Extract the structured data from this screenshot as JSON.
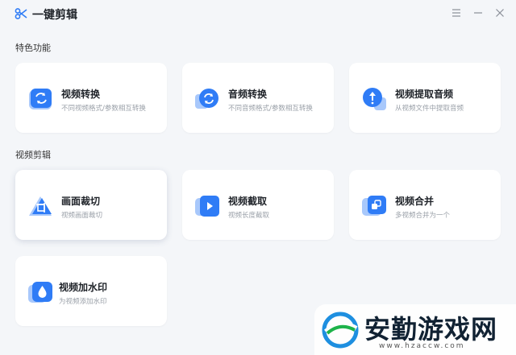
{
  "app": {
    "title": "一键剪辑"
  },
  "sections": [
    {
      "title": "特色功能",
      "cards": [
        {
          "title": "视频转换",
          "desc": "不同视频格式/参数相互转换",
          "icon": "video-convert-icon"
        },
        {
          "title": "音频转换",
          "desc": "不同音频格式/参数相互转换",
          "icon": "audio-convert-icon"
        },
        {
          "title": "视频提取音频",
          "desc": "从视频文件中提取音频",
          "icon": "extract-audio-icon"
        }
      ]
    },
    {
      "title": "视频剪辑",
      "cards": [
        {
          "title": "画面裁切",
          "desc": "视频画面裁切",
          "icon": "crop-icon"
        },
        {
          "title": "视频截取",
          "desc": "视频长度截取",
          "icon": "trim-icon"
        },
        {
          "title": "视频合并",
          "desc": "多视频合并为一个",
          "icon": "merge-icon"
        },
        {
          "title": "视频加水印",
          "desc": "为视频添加水印",
          "icon": "watermark-drop-icon"
        }
      ]
    }
  ],
  "watermark": {
    "text": "安勤游戏网",
    "url": "www.hzaccw.com"
  },
  "colors": {
    "accent": "#2f7cf6",
    "background": "#f4f6f9"
  }
}
